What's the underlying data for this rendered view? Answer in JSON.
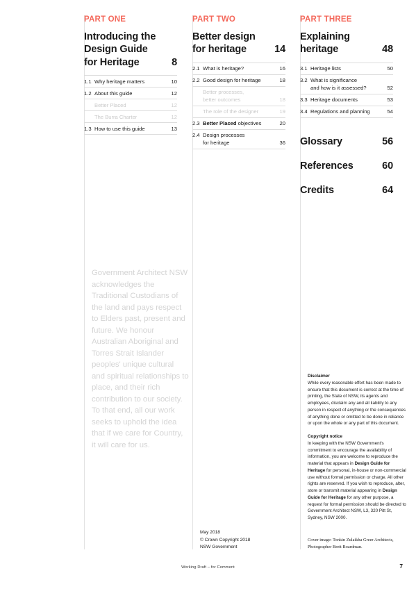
{
  "colors": {
    "accent_red": "#F4685B",
    "muted_grey": "#D4D4D4",
    "rule_grey": "#DDDDDD",
    "text_black": "#1A1A1A"
  },
  "columns": [
    {
      "part_label": "PART ONE",
      "title_lines": [
        "Introducing the",
        "Design Guide",
        "for Heritage"
      ],
      "title_page": "8",
      "toc": [
        {
          "num": "1.1",
          "label": "Why heritage matters",
          "page": "10",
          "sub": false
        },
        {
          "num": "1.2",
          "label": "About this guide",
          "page": "12",
          "sub": false
        },
        {
          "num": "",
          "label": "Better Placed",
          "page": "12",
          "sub": true
        },
        {
          "num": "",
          "label": "The Burra Charter",
          "page": "12",
          "sub": true
        },
        {
          "num": "1.3",
          "label": "How to use this guide",
          "page": "13",
          "sub": false
        }
      ]
    },
    {
      "part_label": "PART TWO",
      "title_lines": [
        "Better design",
        "for heritage"
      ],
      "title_page": "14",
      "toc": [
        {
          "num": "2.1",
          "label": "What is heritage?",
          "page": "16",
          "sub": false
        },
        {
          "num": "2.2",
          "label": "Good design for heritage",
          "page": "18",
          "sub": false
        },
        {
          "num": "",
          "label": "Better processes,\nbetter outcomes",
          "page": "18",
          "sub": true
        },
        {
          "num": "",
          "label": "The role of the designer",
          "page": "19",
          "sub": true
        },
        {
          "num": "2.3",
          "label_html": "<b>Better Placed</b> objectives",
          "label": "Better Placed objectives",
          "page": "20",
          "sub": false
        },
        {
          "num": "2.4",
          "label": "Design processes\nfor heritage",
          "page": "36",
          "sub": false
        }
      ]
    },
    {
      "part_label": "PART THREE",
      "title_lines": [
        "Explaining",
        "heritage"
      ],
      "title_page": "48",
      "toc": [
        {
          "num": "3.1",
          "label": "Heritage lists",
          "page": "50",
          "sub": false
        },
        {
          "num": "3.2",
          "label": "What is significance\nand how is it assessed?",
          "page": "52",
          "sub": false
        },
        {
          "num": "3.3",
          "label": "Heritage documents",
          "page": "53",
          "sub": false
        },
        {
          "num": "3.4",
          "label": "Regulations and planning",
          "page": "54",
          "sub": false
        }
      ],
      "backmatter": [
        {
          "label": "Glossary",
          "page": "56"
        },
        {
          "label": "References",
          "page": "60"
        },
        {
          "label": "Credits",
          "page": "64"
        }
      ]
    }
  ],
  "acknowledgement": "Government Architect NSW acknowledges the Traditional Custodians of the land and pays respect to Elders past, present and future. We honour Australian Aboriginal and Torres Strait Islander peoples' unique cultural and spiritual relationships to place, and their rich contribution to our society. To that end, all our work seeks to uphold the idea that if we care for Country, it will care for us.",
  "imprint": {
    "date": "May 2018",
    "copyright": "© Crown Copyright 2018",
    "publisher": "NSW Government"
  },
  "legal": {
    "disclaimer_heading": "Disclaimer",
    "disclaimer_body": "While every reasonable effort has been made to ensure that this document is correct at the time of printing, the State of NSW, its agents and employees, disclaim any and all liability to any person in respect of anything or the consequences of anything done or omitted to be done in reliance or upon the whole or any part of this document.",
    "copyright_heading": "Copyright notice",
    "copyright_body_1": "In keeping with the NSW Government's commitment to encourage the availability of information, you are welcome to reproduce the material that appears in ",
    "copyright_italic_1": "Design Guide for Heritage",
    "copyright_body_2": " for personal, in-house or non-commercial use without formal permission or charge. All other rights are reserved. If you wish to reproduce, alter, store or transmit material appearing in ",
    "copyright_italic_2": "Design Guide for Heritage",
    "copyright_body_3": " for any other purpose, a request for formal permission should be directed to Government Architect NSW, L3, 320 Pitt St, Sydney, NSW 2000."
  },
  "cover_credit": "Cover image: Tonkin Zulaikha Greer Architects, Photographer Brett Boardman.",
  "footer": {
    "note": "Working Draft – for Comment",
    "page_number": "7"
  }
}
